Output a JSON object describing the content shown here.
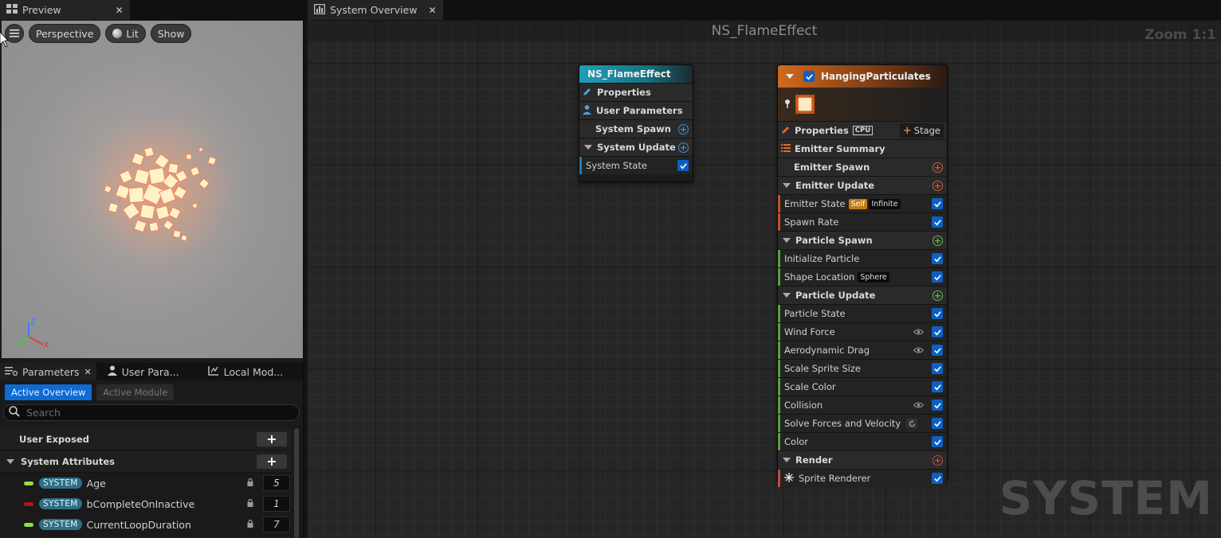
{
  "preview_tab": {
    "label": "Preview"
  },
  "viewport": {
    "perspective": "Perspective",
    "lit": "Lit",
    "show": "Show",
    "axis_x": "X",
    "axis_z": "Z"
  },
  "params_tabs": {
    "parameters": "Parameters",
    "user_params": "User Para...",
    "local_mod": "Local Mod..."
  },
  "subtabs": {
    "active_overview": "Active Overview",
    "active_module": "Active Module"
  },
  "search": {
    "placeholder": "Search"
  },
  "param_sections": {
    "user_exposed": "User Exposed",
    "system_attributes": "System Attributes",
    "rows": [
      {
        "tag": "SYSTEM",
        "name": "Age",
        "value": "5",
        "dot": "#8ee04a"
      },
      {
        "tag": "SYSTEM",
        "name": "bCompleteOnInactive",
        "value": "1",
        "dot": "#b01515"
      },
      {
        "tag": "SYSTEM",
        "name": "CurrentLoopDuration",
        "value": "7",
        "dot": "#8ee04a"
      }
    ]
  },
  "graph_tab": {
    "label": "System Overview"
  },
  "graph": {
    "title": "NS_FlameEffect",
    "zoom": "Zoom 1:1",
    "watermark": "SYSTEM"
  },
  "system_node": {
    "title": "NS_FlameEffect",
    "properties": "Properties",
    "user_parameters": "User Parameters",
    "system_spawn": "System Spawn",
    "system_update": "System Update",
    "system_state": "System State"
  },
  "emitter_node": {
    "title": "HangingParticulates",
    "properties": "Properties",
    "cpu": "CPU",
    "stage": "Stage",
    "emitter_summary": "Emitter Summary",
    "emitter_spawn": "Emitter Spawn",
    "emitter_update": "Emitter Update",
    "emitter_state": "Emitter State",
    "badge_self": "Self",
    "badge_infinite": "Infinite",
    "spawn_rate": "Spawn Rate",
    "particle_spawn": "Particle Spawn",
    "initialize_particle": "Initialize Particle",
    "shape_location": "Shape Location",
    "badge_sphere": "Sphere",
    "particle_update": "Particle Update",
    "particle_state": "Particle State",
    "wind_force": "Wind Force",
    "aerodynamic_drag": "Aerodynamic Drag",
    "scale_sprite_size": "Scale Sprite Size",
    "scale_color": "Scale Color",
    "collision": "Collision",
    "solve_forces": "Solve Forces and Velocity",
    "color": "Color",
    "render": "Render",
    "sprite_renderer": "Sprite Renderer"
  },
  "colors": {
    "accent_blue": "#0e6bd4",
    "emitter_header": "#c45a14",
    "system_header": "#1c8aa0"
  }
}
